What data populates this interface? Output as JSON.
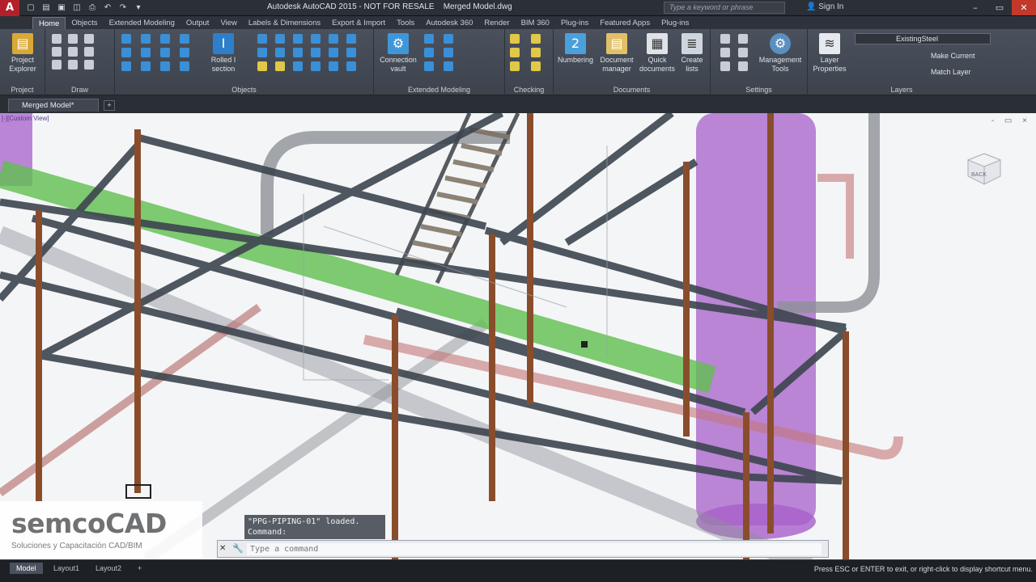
{
  "app": {
    "title": "Autodesk AutoCAD 2015 - NOT FOR RESALE",
    "document": "Merged Model.dwg",
    "logo": "A"
  },
  "titlebar": {
    "search_placeholder": "Type a keyword or phrase",
    "signin": "Sign In"
  },
  "ribbon_tabs": [
    "Home",
    "Objects",
    "Extended Modeling",
    "Output",
    "View",
    "Labels & Dimensions",
    "Export & Import",
    "Tools",
    "Autodesk 360",
    "Render",
    "BIM 360",
    "Plug-ins",
    "Featured Apps",
    "Plug-ins"
  ],
  "active_tab": "Home",
  "panels": {
    "project": {
      "label": "Project",
      "btn": "Project Explorer"
    },
    "draw": {
      "label": "Draw"
    },
    "objects": {
      "label": "Objects",
      "btn": "Rolled I section"
    },
    "extended": {
      "label": "Extended Modeling",
      "btn": "Connection vault"
    },
    "checking": {
      "label": "Checking"
    },
    "documents": {
      "label": "Documents",
      "numbering": "Numbering",
      "docmanager": "Document manager",
      "quickdocs": "Quick documents",
      "createlists": "Create lists"
    },
    "settings": {
      "label": "Settings",
      "mgmt": "Management Tools"
    },
    "layers": {
      "label": "Layers",
      "btn": "Layer Properties",
      "current_layer": "ExistingSteel",
      "make_current": "Make Current",
      "match_layer": "Match Layer"
    }
  },
  "file_tab": {
    "name": "Merged Model*",
    "new": "+"
  },
  "viewport": {
    "label": "[-][Custom View]",
    "controls": "- ▭ ×",
    "cube_face": "BACK"
  },
  "watermark": {
    "name": "semcoCAD",
    "tagline": "Soluciones y Capacitación CAD/BIM"
  },
  "command": {
    "history": [
      "\"PPG-PIPING-01\" loaded.",
      "Command:"
    ],
    "placeholder": "Type a command"
  },
  "layout_tabs": [
    "Model",
    "Layout1",
    "Layout2",
    "+"
  ],
  "status_message": "Press ESC or ENTER to exit, or right-click to display shortcut menu."
}
